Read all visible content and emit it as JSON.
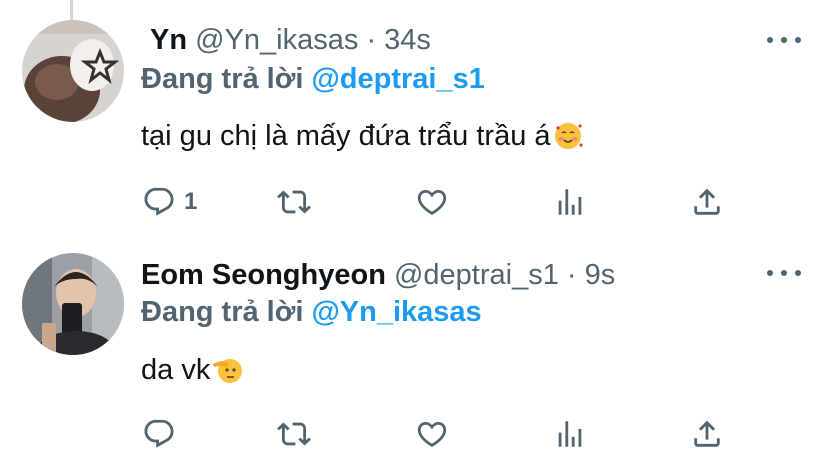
{
  "tweets": [
    {
      "name": "Yn",
      "handle": "@Yn_ikasas",
      "dot": "·",
      "time": "34s",
      "reply_prefix": "Đang trả lời",
      "reply_to": "@deptrai_s1",
      "text": "tại gu chị là mấy đứa trẩu trầu á",
      "emoji": "smiling-face-with-hearts",
      "reply_count": "1"
    },
    {
      "name": "Eom Seonghyeon",
      "handle": "@deptrai_s1",
      "dot": "·",
      "time": "9s",
      "reply_prefix": "Đang trả lời",
      "reply_to": "@Yn_ikasas",
      "text": "da vk",
      "emoji": "saluting-face",
      "reply_count": ""
    }
  ],
  "colors": {
    "accent": "#1d9bf0",
    "muted": "#536471",
    "text": "#0f1419",
    "thread_line": "#cfd9de"
  },
  "icons": [
    "reply-icon",
    "retweet-icon",
    "like-icon",
    "views-icon",
    "share-icon",
    "more-icon"
  ]
}
